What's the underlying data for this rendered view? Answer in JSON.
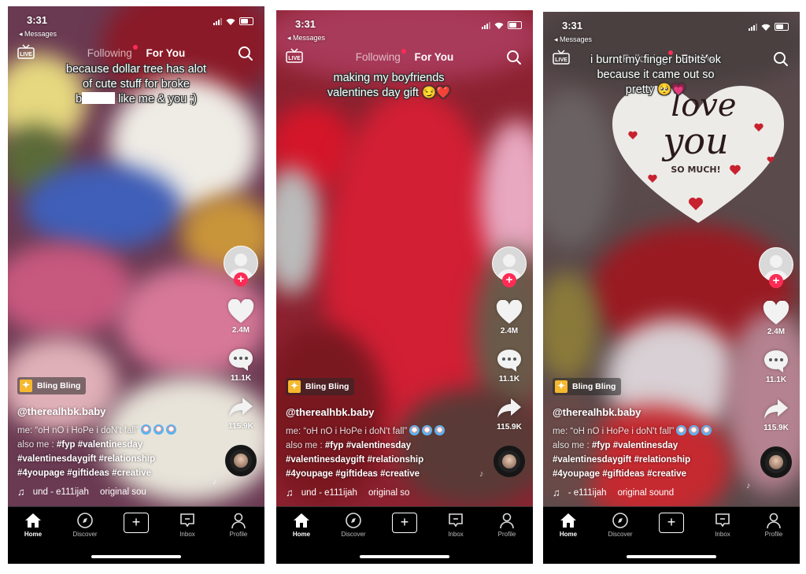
{
  "common": {
    "status_time": "3:31",
    "back_label": "◂ Messages",
    "tabs": {
      "following": "Following",
      "for_you": "For You"
    },
    "effect_label": "Bling Bling",
    "username": "@therealhbk.baby",
    "desc_line1": "me: “oH nO i HoPe i doN't fall”",
    "desc_line2_plain": "also me : ",
    "desc_line2_tags": "#fyp #valentinesday",
    "desc_line3": "#valentinesdaygift #relationship",
    "desc_line4": "#4youpage #giftideas #creative",
    "likes": "2.4M",
    "comments": "11.1K",
    "shares": "115.9K",
    "nav": {
      "home": "Home",
      "discover": "Discover",
      "create": "+",
      "inbox": "Inbox",
      "profile": "Profile"
    },
    "accent": "#fe2c55"
  },
  "panels": [
    {
      "caption_lines": [
        "because dollar tree has alot",
        "of cute stuff for broke",
        "like me & you ;)"
      ],
      "caption_censored_prefix": "b",
      "music_artist": "und - e111ijah",
      "music_title": "original sou"
    },
    {
      "caption_lines": [
        "making my boyfriends",
        "valentines day gift 😏❤️"
      ],
      "music_artist": "und - e111ijah",
      "music_title": "original so"
    },
    {
      "caption_lines": [
        "i burnt my finger but its ok",
        "because it came out so",
        "pretty 🥺💗"
      ],
      "balloon_text": {
        "line1": "love",
        "line2": "you",
        "line3": "SO MUCH!"
      },
      "music_artist": "- e111ijah",
      "music_title": "original sound"
    }
  ]
}
